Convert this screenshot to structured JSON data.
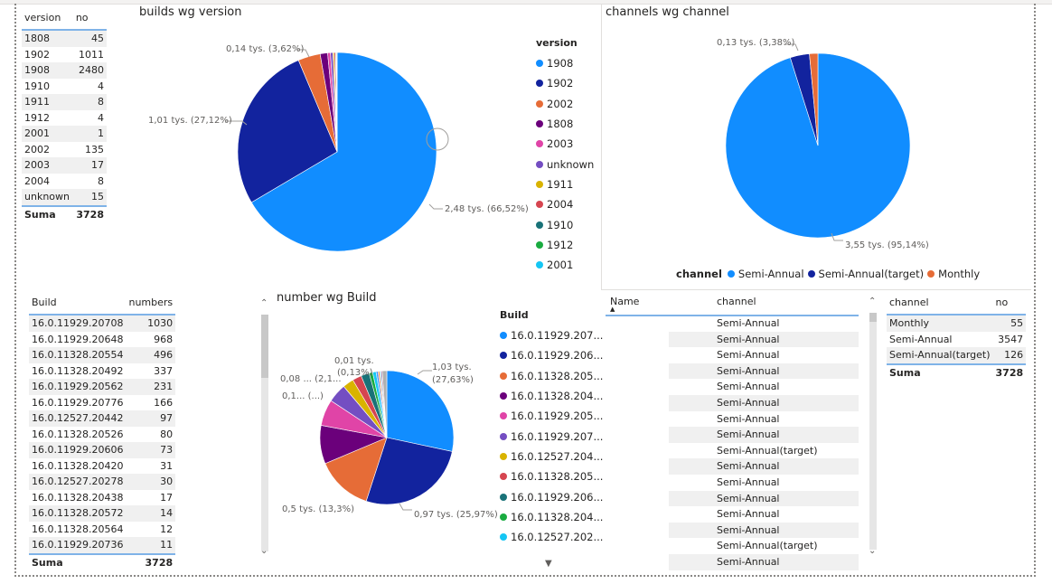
{
  "colors": {
    "blue": "#118DFF",
    "navy": "#12239E",
    "orange": "#E66C37",
    "purple": "#6B007B",
    "pink": "#E044A7",
    "violet": "#744EC2",
    "gold": "#D9B300",
    "red": "#D64550",
    "teal": "#197278",
    "green": "#1AAB40",
    "cyan": "#15C6F4"
  },
  "version_table": {
    "headers": [
      "version",
      "no"
    ],
    "rows": [
      [
        "1808",
        "45"
      ],
      [
        "1902",
        "1011"
      ],
      [
        "1908",
        "2480"
      ],
      [
        "1910",
        "4"
      ],
      [
        "1911",
        "8"
      ],
      [
        "1912",
        "4"
      ],
      [
        "2001",
        "1"
      ],
      [
        "2002",
        "135"
      ],
      [
        "2003",
        "17"
      ],
      [
        "2004",
        "8"
      ],
      [
        "unknown",
        "15"
      ]
    ],
    "total": [
      "Suma",
      "3728"
    ]
  },
  "builds_chart": {
    "title": "builds wg version",
    "legend_title": "version",
    "legend": [
      [
        "1908",
        "#118DFF"
      ],
      [
        "1902",
        "#12239E"
      ],
      [
        "2002",
        "#E66C37"
      ],
      [
        "1808",
        "#6B007B"
      ],
      [
        "2003",
        "#E044A7"
      ],
      [
        "unknown",
        "#744EC2"
      ],
      [
        "1911",
        "#D9B300"
      ],
      [
        "2004",
        "#D64550"
      ],
      [
        "1910",
        "#197278"
      ],
      [
        "1912",
        "#1AAB40"
      ],
      [
        "2001",
        "#15C6F4"
      ]
    ],
    "labels": {
      "a": "0,14 tys. (3,62%)",
      "b": "1,01 tys. (27,12%)",
      "c": "2,48 tys. (66,52%)"
    }
  },
  "channels_chart": {
    "title": "channels wg channel",
    "labels": {
      "a": "0,13 tys. (3,38%)",
      "b": "3,55 tys. (95,14%)"
    },
    "legend_title": "channel",
    "legend": [
      [
        "Semi-Annual",
        "#118DFF"
      ],
      [
        "Semi-Annual(target)",
        "#12239E"
      ],
      [
        "Monthly",
        "#E66C37"
      ]
    ]
  },
  "build_table": {
    "headers": [
      "Build",
      "numbers"
    ],
    "rows": [
      [
        "16.0.11929.20708",
        "1030"
      ],
      [
        "16.0.11929.20648",
        "968"
      ],
      [
        "16.0.11328.20554",
        "496"
      ],
      [
        "16.0.11328.20492",
        "337"
      ],
      [
        "16.0.11929.20562",
        "231"
      ],
      [
        "16.0.11929.20776",
        "166"
      ],
      [
        "16.0.12527.20442",
        "97"
      ],
      [
        "16.0.11328.20526",
        "80"
      ],
      [
        "16.0.11929.20606",
        "73"
      ],
      [
        "16.0.11328.20420",
        "31"
      ],
      [
        "16.0.12527.20278",
        "30"
      ],
      [
        "16.0.11328.20438",
        "17"
      ],
      [
        "16.0.11328.20572",
        "14"
      ],
      [
        "16.0.11328.20564",
        "12"
      ],
      [
        "16.0.11929.20736",
        "11"
      ]
    ],
    "total": [
      "Suma",
      "3728"
    ]
  },
  "number_chart": {
    "title": "number wg Build",
    "legend_title": "Build",
    "legend": [
      [
        "16.0.11929.207...",
        "#118DFF"
      ],
      [
        "16.0.11929.206...",
        "#12239E"
      ],
      [
        "16.0.11328.205...",
        "#E66C37"
      ],
      [
        "16.0.11328.204...",
        "#6B007B"
      ],
      [
        "16.0.11929.205...",
        "#E044A7"
      ],
      [
        "16.0.11929.207...",
        "#744EC2"
      ],
      [
        "16.0.12527.204...",
        "#D9B300"
      ],
      [
        "16.0.11328.205...",
        "#D64550"
      ],
      [
        "16.0.11929.206...",
        "#197278"
      ],
      [
        "16.0.11328.204...",
        "#1AAB40"
      ],
      [
        "16.0.12527.202...",
        "#15C6F4"
      ]
    ],
    "labels": {
      "a": "1,03 tys.",
      "a2": "(27,63%)",
      "b": "0,97 tys. (25,97%)",
      "c": "0,5 tys. (13,3%)",
      "d": "0,01 tys.",
      "d2": "(0,13%)",
      "e": "0,08 ... (2,1...",
      "f": "0,1... (...)"
    }
  },
  "name_table": {
    "headers": [
      "Name",
      "channel"
    ],
    "rows": [
      "Semi-Annual",
      "Semi-Annual",
      "Semi-Annual",
      "Semi-Annual",
      "Semi-Annual",
      "Semi-Annual",
      "Semi-Annual",
      "Semi-Annual",
      "Semi-Annual(target)",
      "Semi-Annual",
      "Semi-Annual",
      "Semi-Annual",
      "Semi-Annual",
      "Semi-Annual",
      "Semi-Annual(target)",
      "Semi-Annual"
    ]
  },
  "channel_table": {
    "headers": [
      "channel",
      "no"
    ],
    "rows": [
      [
        "Monthly",
        "55"
      ],
      [
        "Semi-Annual",
        "3547"
      ],
      [
        "Semi-Annual(target)",
        "126"
      ]
    ],
    "total": [
      "Suma",
      "3728"
    ]
  }
}
